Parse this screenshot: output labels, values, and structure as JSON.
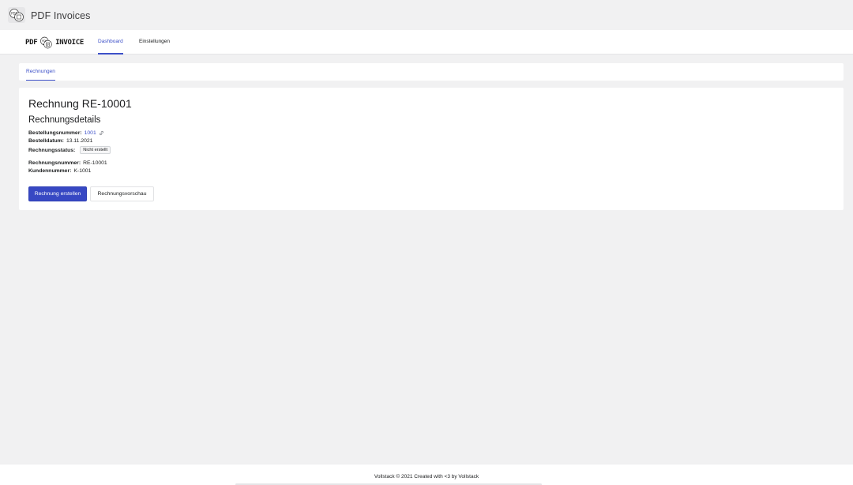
{
  "app": {
    "title": "PDF Invoices",
    "icon": "invoice-logo-icon"
  },
  "brand": {
    "left_text": "PDF",
    "right_text": "INVOICE",
    "icon": "invoice-logo-icon"
  },
  "nav": {
    "tabs": [
      {
        "label": "Dashboard",
        "active": true
      },
      {
        "label": "Einstellungen",
        "active": false
      }
    ]
  },
  "subnav": {
    "tabs": [
      {
        "label": "Rechnungen",
        "active": true
      }
    ]
  },
  "invoice": {
    "title": "Rechnung RE-10001",
    "section_title": "Rechnungsdetails",
    "order_number_label": "Bestellungsnummer:",
    "order_number_value": "1001",
    "order_link_icon": "link-icon",
    "order_date_label": "Bestelldatum:",
    "order_date_value": "13.11.2021",
    "status_label": "Rechnungsstatus:",
    "status_value": "Nicht erstellt",
    "invoice_number_label": "Rechnungsnummer:",
    "invoice_number_value": "RE-10001",
    "customer_number_label": "Kundennummer:",
    "customer_number_value": "K-1001",
    "create_button": "Rechnung erstellen",
    "preview_button": "Rechnungsvorschau"
  },
  "footer": {
    "text": "Vollstack © 2021 Created with <3 by Vollstack"
  },
  "colors": {
    "accent": "#3d50c8",
    "primary_button": "#3748c3",
    "background": "#f1f1f2"
  }
}
